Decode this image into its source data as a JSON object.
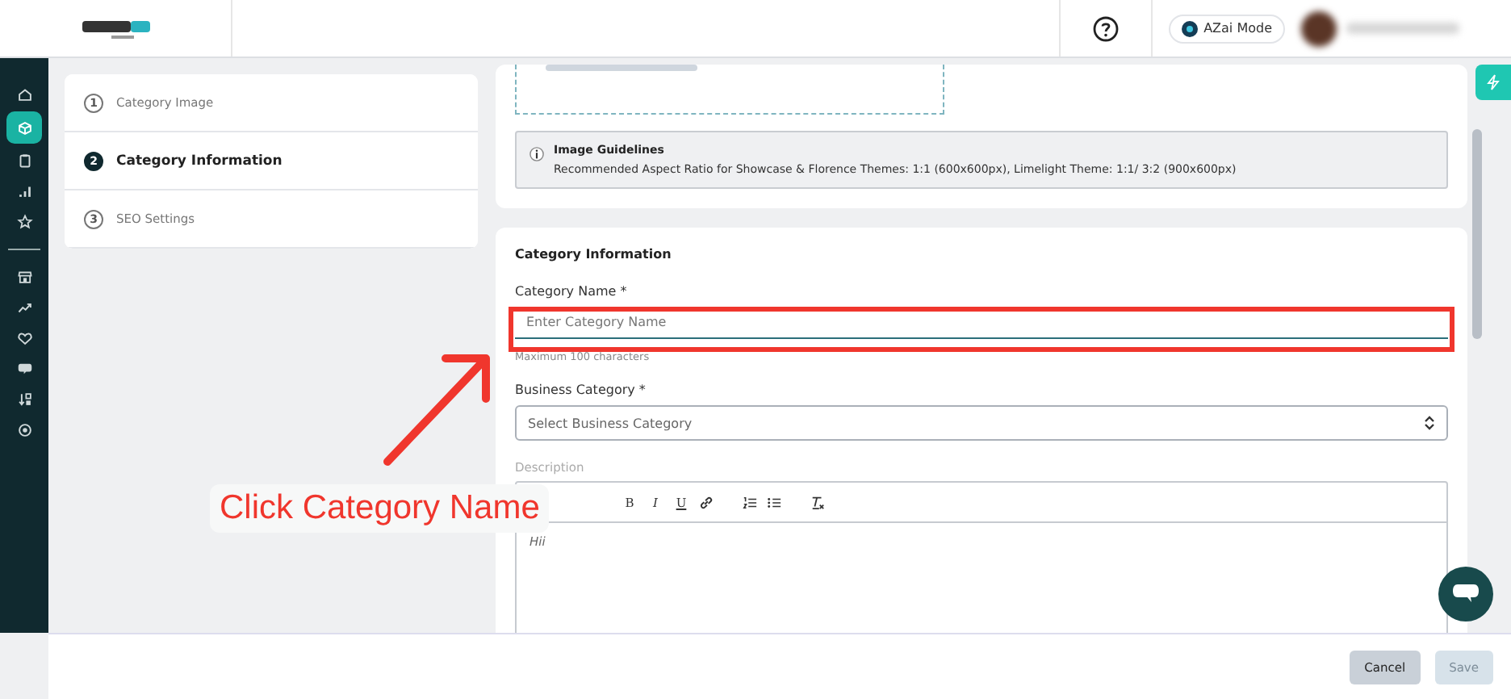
{
  "header": {
    "mode_button": "AZai Mode"
  },
  "sidebar": {
    "items": [
      {
        "selected": false
      },
      {
        "selected": true
      },
      {
        "selected": false
      },
      {
        "selected": false
      },
      {
        "selected": false
      },
      {
        "selected": false
      },
      {
        "selected": false
      },
      {
        "selected": false
      },
      {
        "selected": false
      },
      {
        "selected": false
      },
      {
        "selected": false
      }
    ]
  },
  "steps": [
    {
      "number": "1",
      "label": "Category Image",
      "selected": false
    },
    {
      "number": "2",
      "label": "Category Information",
      "selected": true
    },
    {
      "number": "3",
      "label": "SEO Settings",
      "selected": false
    }
  ],
  "guidelines": {
    "title": "Image Guidelines",
    "text": "Recommended Aspect Ratio for Showcase & Florence Themes: 1:1 (600x600px), Limelight Theme: 1:1/ 3:2 (900x600px)"
  },
  "form": {
    "title": "Category Information",
    "fields": [
      {
        "kind": "text",
        "label": "Category Name *",
        "placeholder": "Enter Category Name",
        "hint": "Maximum 100 characters"
      },
      {
        "kind": "select",
        "label": "Business Category *",
        "placeholder": "Select Business Category"
      }
    ],
    "description": {
      "label": "Description",
      "toolbar": [
        "B",
        "I",
        "U"
      ],
      "value": "Hii"
    }
  },
  "footer": {
    "buttons": [
      {
        "label": "Cancel",
        "disabled": false
      },
      {
        "label": "Save",
        "disabled": true
      }
    ]
  },
  "annotation": {
    "text": "Click Category Name"
  }
}
